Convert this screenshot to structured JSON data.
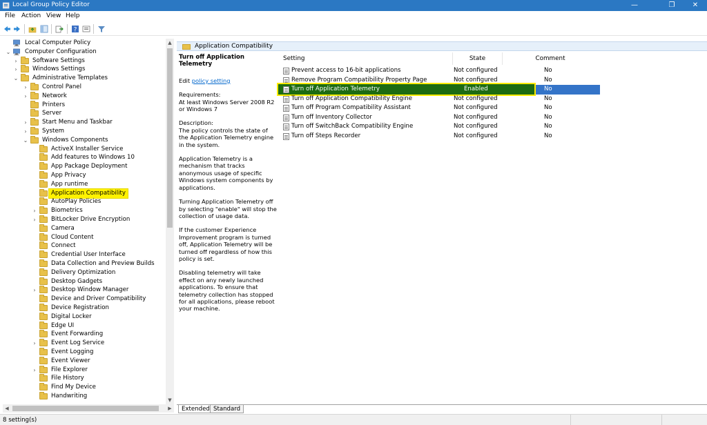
{
  "window": {
    "title": "Local Group Policy Editor",
    "minimize": "—",
    "maximize": "❐",
    "close": "✕"
  },
  "menu": [
    "File",
    "Action",
    "View",
    "Help"
  ],
  "toolbar": {
    "icons": [
      "back-icon",
      "forward-icon",
      "up-folder-icon",
      "show-hide-tree-icon",
      "export-list-icon",
      "help-icon",
      "properties-icon",
      "filter-icon"
    ]
  },
  "tree": [
    {
      "label": "Local Computer Policy",
      "level": 0,
      "arrow": "",
      "icon": "computer"
    },
    {
      "label": "Computer Configuration",
      "level": 0,
      "arrow": "expanded",
      "icon": "computer"
    },
    {
      "label": "Software Settings",
      "level": 1,
      "arrow": "collapsed",
      "icon": "folder"
    },
    {
      "label": "Windows Settings",
      "level": 1,
      "arrow": "collapsed",
      "icon": "folder"
    },
    {
      "label": "Administrative Templates",
      "level": 1,
      "arrow": "expanded",
      "icon": "folder"
    },
    {
      "label": "Control Panel",
      "level": 2,
      "arrow": "collapsed",
      "icon": "folder"
    },
    {
      "label": "Network",
      "level": 2,
      "arrow": "collapsed",
      "icon": "folder"
    },
    {
      "label": "Printers",
      "level": 2,
      "arrow": "",
      "icon": "folder"
    },
    {
      "label": "Server",
      "level": 2,
      "arrow": "",
      "icon": "folder"
    },
    {
      "label": "Start Menu and Taskbar",
      "level": 2,
      "arrow": "collapsed",
      "icon": "folder"
    },
    {
      "label": "System",
      "level": 2,
      "arrow": "collapsed",
      "icon": "folder"
    },
    {
      "label": "Windows Components",
      "level": 2,
      "arrow": "expanded",
      "icon": "folder"
    },
    {
      "label": "ActiveX Installer Service",
      "level": 3,
      "arrow": "",
      "icon": "folder"
    },
    {
      "label": "Add features to Windows 10",
      "level": 3,
      "arrow": "",
      "icon": "folder"
    },
    {
      "label": "App Package Deployment",
      "level": 3,
      "arrow": "",
      "icon": "folder"
    },
    {
      "label": "App Privacy",
      "level": 3,
      "arrow": "",
      "icon": "folder"
    },
    {
      "label": "App runtime",
      "level": 3,
      "arrow": "",
      "icon": "folder"
    },
    {
      "label": "Application Compatibility",
      "level": 3,
      "arrow": "",
      "icon": "folder",
      "selected": true
    },
    {
      "label": "AutoPlay Policies",
      "level": 3,
      "arrow": "",
      "icon": "folder"
    },
    {
      "label": "Biometrics",
      "level": 3,
      "arrow": "collapsed",
      "icon": "folder"
    },
    {
      "label": "BitLocker Drive Encryption",
      "level": 3,
      "arrow": "collapsed",
      "icon": "folder"
    },
    {
      "label": "Camera",
      "level": 3,
      "arrow": "",
      "icon": "folder"
    },
    {
      "label": "Cloud Content",
      "level": 3,
      "arrow": "",
      "icon": "folder"
    },
    {
      "label": "Connect",
      "level": 3,
      "arrow": "",
      "icon": "folder"
    },
    {
      "label": "Credential User Interface",
      "level": 3,
      "arrow": "",
      "icon": "folder"
    },
    {
      "label": "Data Collection and Preview Builds",
      "level": 3,
      "arrow": "",
      "icon": "folder"
    },
    {
      "label": "Delivery Optimization",
      "level": 3,
      "arrow": "",
      "icon": "folder"
    },
    {
      "label": "Desktop Gadgets",
      "level": 3,
      "arrow": "",
      "icon": "folder"
    },
    {
      "label": "Desktop Window Manager",
      "level": 3,
      "arrow": "collapsed",
      "icon": "folder"
    },
    {
      "label": "Device and Driver Compatibility",
      "level": 3,
      "arrow": "",
      "icon": "folder"
    },
    {
      "label": "Device Registration",
      "level": 3,
      "arrow": "",
      "icon": "folder"
    },
    {
      "label": "Digital Locker",
      "level": 3,
      "arrow": "",
      "icon": "folder"
    },
    {
      "label": "Edge UI",
      "level": 3,
      "arrow": "",
      "icon": "folder"
    },
    {
      "label": "Event Forwarding",
      "level": 3,
      "arrow": "",
      "icon": "folder"
    },
    {
      "label": "Event Log Service",
      "level": 3,
      "arrow": "collapsed",
      "icon": "folder"
    },
    {
      "label": "Event Logging",
      "level": 3,
      "arrow": "",
      "icon": "folder"
    },
    {
      "label": "Event Viewer",
      "level": 3,
      "arrow": "",
      "icon": "folder"
    },
    {
      "label": "File Explorer",
      "level": 3,
      "arrow": "collapsed",
      "icon": "folder"
    },
    {
      "label": "File History",
      "level": 3,
      "arrow": "",
      "icon": "folder"
    },
    {
      "label": "Find My Device",
      "level": 3,
      "arrow": "",
      "icon": "folder"
    },
    {
      "label": "Handwriting",
      "level": 3,
      "arrow": "",
      "icon": "folder"
    }
  ],
  "right_header": "Application Compatibility",
  "description": {
    "title": "Turn off Application Telemetry",
    "edit_prefix": "Edit ",
    "edit_link": "policy setting",
    "requirements": "Requirements:\nAt least Windows Server 2008 R2 or Windows 7",
    "description": "Description:\nThe policy controls the state of the Application Telemetry engine in the system.",
    "para1": "Application Telemetry is a mechanism that tracks anonymous usage of specific Windows system components by applications.",
    "para2": "Turning Application Telemetry off by selecting \"enable\" will stop the collection of usage data.",
    "para3": "If the customer Experience Improvement program is turned off, Application Telemetry will be turned off regardless of how this policy is set.",
    "para4": "Disabling telemetry will take effect on any newly launched applications. To ensure that telemetry collection has stopped for all applications, please reboot your machine."
  },
  "columns": {
    "setting": "Setting",
    "state": "State",
    "comment": "Comment"
  },
  "rows": [
    {
      "setting": "Prevent access to 16-bit applications",
      "state": "Not configured",
      "comment": "No"
    },
    {
      "setting": "Remove Program Compatibility Property Page",
      "state": "Not configured",
      "comment": "No"
    },
    {
      "setting": "Turn off Application Telemetry",
      "state": "Enabled",
      "comment": "No",
      "selected": true
    },
    {
      "setting": "Turn off Application Compatibility Engine",
      "state": "Not configured",
      "comment": "No"
    },
    {
      "setting": "Turn off Program Compatibility Assistant",
      "state": "Not configured",
      "comment": "No"
    },
    {
      "setting": "Turn off Inventory Collector",
      "state": "Not configured",
      "comment": "No"
    },
    {
      "setting": "Turn off SwitchBack Compatibility Engine",
      "state": "Not configured",
      "comment": "No"
    },
    {
      "setting": "Turn off Steps Recorder",
      "state": "Not configured",
      "comment": "No"
    }
  ],
  "tabs": [
    "Extended",
    "Standard"
  ],
  "status": "8 setting(s)",
  "colors": {
    "titlebar": "#2b78c3",
    "selection": "#3474c8",
    "highlight_green": "#1d6b12",
    "highlight_yellow": "#fff200"
  }
}
